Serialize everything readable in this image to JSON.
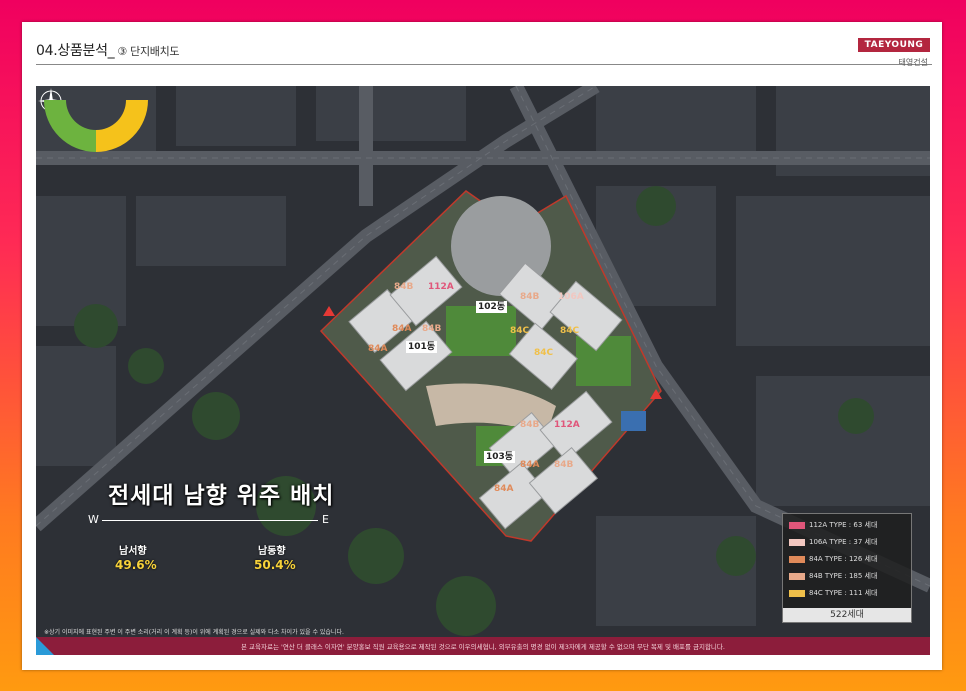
{
  "header": {
    "section": "04.상품분석_",
    "subsection": "③ 단지배치도",
    "logo": "TAEYOUNG",
    "logo_sub": "태영건설"
  },
  "map": {
    "buildings": [
      "101동",
      "102동",
      "103동"
    ],
    "unit_labels": [
      "84B",
      "112A",
      "84B",
      "106A",
      "84A",
      "84B",
      "84C",
      "84C",
      "84A",
      "84C",
      "84B",
      "112A",
      "84A",
      "84B",
      "84A"
    ],
    "headline": "전세대 남향 위주 배치",
    "axis_west": "W",
    "axis_east": "E",
    "orientation": [
      {
        "label": "남서향",
        "value": "49.6%",
        "color": "#6db33f"
      },
      {
        "label": "남동향",
        "value": "50.4%",
        "color": "#f5c21b"
      }
    ]
  },
  "legend": {
    "items": [
      {
        "type": "112A TYPE",
        "count": "63 세대",
        "color": "#e0567a"
      },
      {
        "type": "106A TYPE",
        "count": "37 세대",
        "color": "#f2c7c0"
      },
      {
        "type": "84A TYPE",
        "count": "126 세대",
        "color": "#e08a5a"
      },
      {
        "type": "84B TYPE",
        "count": "185 세대",
        "color": "#e8a98a"
      },
      {
        "type": "84C TYPE",
        "count": "111 세대",
        "color": "#f0c04a"
      }
    ],
    "total": "522세대"
  },
  "disclaimer": "※상기 이미지에 표현된 주변 이 주변 소리(거리 이 계획 등)이 위에 계획된 경으로 실제와 다소 차이가 있을 수 있습니다.",
  "footer_text": "본 교육자료는 '연산 더 클래스 이자연' 분양홍보 직원 교육용으로 제작된 것으로 이우의세협니, 외부유출의 명경 없이 제3자에게 제공할 수 없으며 무단 복제 및 배포를 금지합니다."
}
